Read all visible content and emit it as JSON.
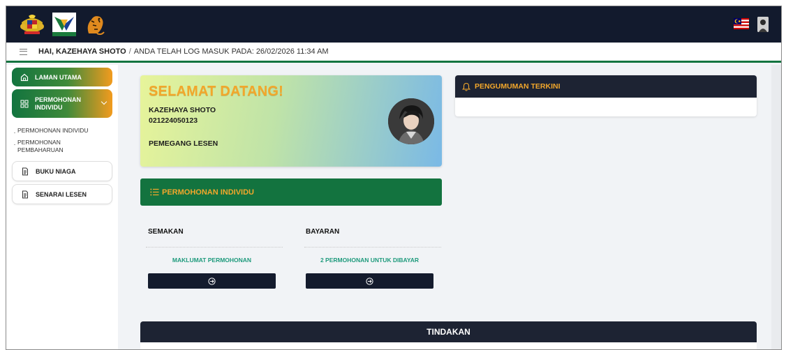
{
  "header": {
    "logos": [
      "malaysia-crest",
      "perhilitan-logo",
      "tiger-emblem"
    ],
    "flag": "malaysia-flag-icon",
    "avatar": "user-avatar"
  },
  "breadcrumb": {
    "greeting": "HAI, KAZEHAYA SHOTO",
    "separator": "/",
    "login_info": "ANDA TELAH LOG MASUK PADA: 26/02/2026 11:34 AM"
  },
  "sidebar": {
    "items": [
      {
        "label": "LAMAN UTAMA",
        "icon": "home-icon"
      },
      {
        "label": "PERMOHONAN INDIVIDU",
        "label_line1": "PERMOHONAN",
        "label_line2": "INDIVIDU",
        "icon": "grid-icon",
        "expanded": true
      },
      {
        "label": "BUKU NIAGA",
        "icon": "document-icon"
      },
      {
        "label": "SENARAI LESEN",
        "icon": "document-icon"
      }
    ],
    "sub_items": [
      {
        "label": "PERMOHONAN INDIVIDU"
      },
      {
        "label_line1": "PERMOHONAN",
        "label_line2": "PEMBAHARUAN"
      }
    ]
  },
  "welcome": {
    "title": "SELAMAT DATANG!",
    "name": "KAZEHAYA SHOTO",
    "id_number": "021224050123",
    "role": "PEMEGANG LESEN"
  },
  "permohonan": {
    "title": "PERMOHONAN INDIVIDU",
    "columns": [
      {
        "label": "SEMAKAN",
        "link": "MAKLUMAT PERMOHONAN"
      },
      {
        "label": "BAYARAN",
        "link": "2 PERMOHONAN UNTUK DIBAYAR"
      }
    ]
  },
  "announcement": {
    "title": "PENGUMUMAN TERKINI"
  },
  "actions": {
    "title": "TINDAKAN"
  },
  "colors": {
    "topbar": "#121a2d",
    "green": "#12743f",
    "orange": "#f29b1e",
    "accent_text": "#f2a72b",
    "link_teal": "#1e9a7c",
    "dark_panel": "#1d2333"
  }
}
